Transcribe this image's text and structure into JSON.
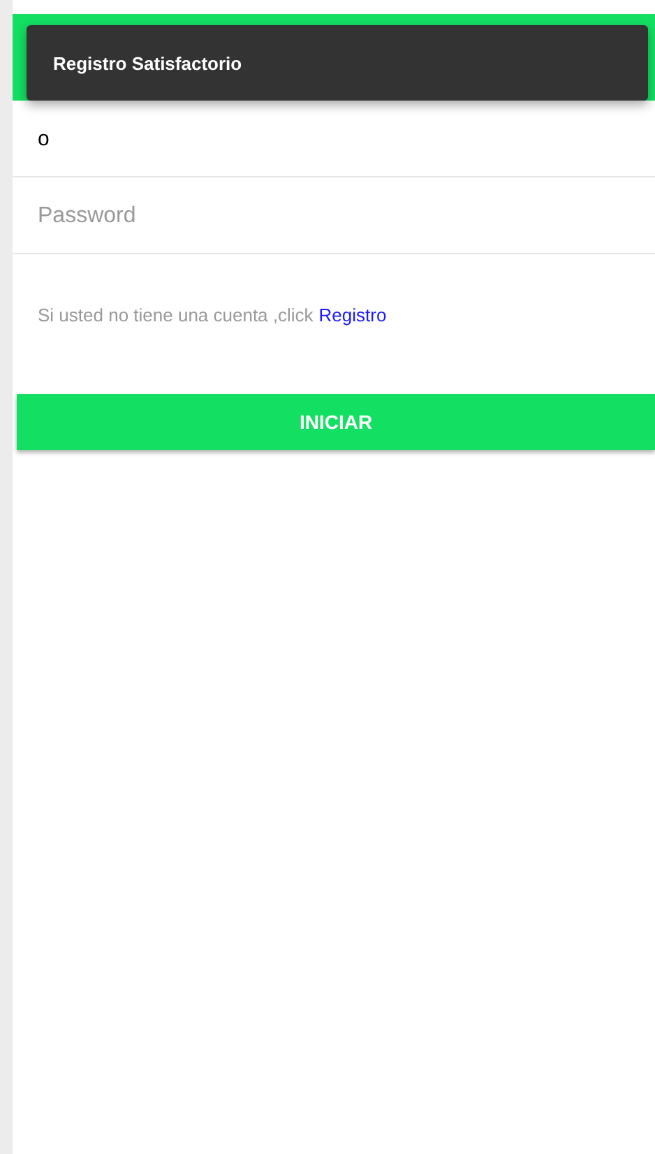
{
  "toast": {
    "message": "Registro Satisfactorio"
  },
  "username": {
    "value": "o"
  },
  "password": {
    "placeholder": "Password"
  },
  "register_hint": {
    "text": "Si usted no tiene una cuenta ,click",
    "link": "Registro"
  },
  "login_button": {
    "label": "INICIAR"
  }
}
